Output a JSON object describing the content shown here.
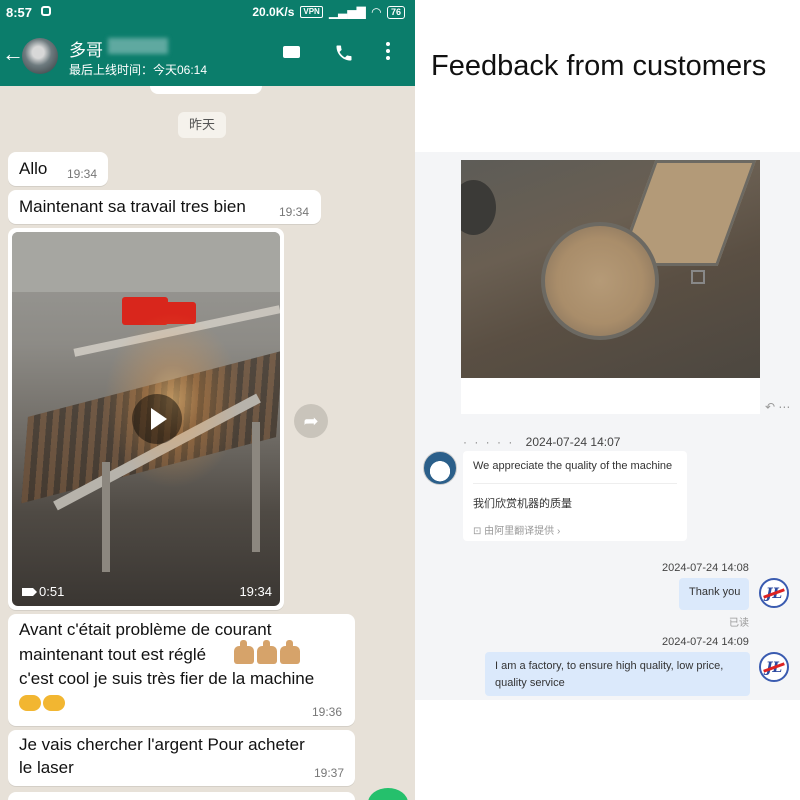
{
  "status_bar": {
    "time": "8:57",
    "network_speed": "20.0K/s",
    "vpn_label": "VPN",
    "battery": "76"
  },
  "chat_header": {
    "contact_name": "多哥",
    "last_seen": "最后上线时间：今天06:14",
    "icons": [
      "back-arrow-icon",
      "video-call-icon",
      "phone-call-icon",
      "more-options-icon"
    ]
  },
  "chat": {
    "date_label": "昨天",
    "messages": [
      {
        "text": "Allo",
        "time": "19:34"
      },
      {
        "text": "Maintenant sa travail tres bien",
        "time": "19:34"
      },
      {
        "type": "video",
        "duration": "0:51",
        "time": "19:34"
      },
      {
        "lines": [
          "Avant c'était problème de courant",
          "maintenant tout est réglé",
          "c'est cool je suis très fier de la machine"
        ],
        "time": "19:36"
      },
      {
        "lines": [
          "Je vais chercher l'argent Pour acheter",
          "le laser"
        ],
        "time": "19:37"
      }
    ]
  },
  "right_panel": {
    "title": "Feedback from customers",
    "customer_message": {
      "timestamp": "2024-07-24 14:07",
      "text_en": "We appreciate the quality of the machine",
      "text_zh": "我们欣赏机器的质量",
      "translation_note": "由阿里翻译提供"
    },
    "replies": [
      {
        "timestamp": "2024-07-24 14:08",
        "text": "Thank you",
        "status": "已读"
      },
      {
        "timestamp": "2024-07-24 14:09",
        "lines": [
          "I am a factory, to ensure high quality, low price,",
          "quality service"
        ]
      }
    ],
    "logo_text": "JL"
  }
}
